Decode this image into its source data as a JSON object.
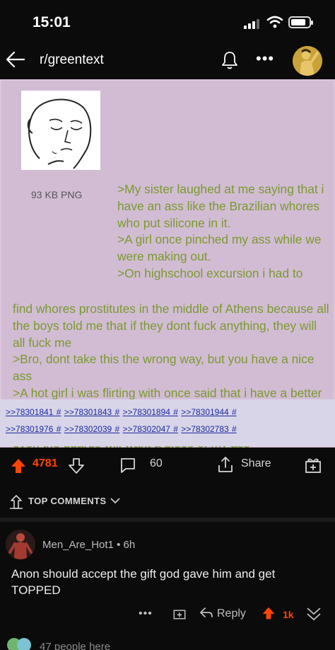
{
  "status_bar": {
    "time": "15:01",
    "battery_level": 0.85
  },
  "header": {
    "subreddit": "r/greentext",
    "more_label": "•••"
  },
  "post": {
    "image_caption": "93 KB PNG",
    "greentext_right": ">My sister laughed at me saying that i have an ass like the Brazilian whores who put silicone in it.\n>A girl once pinched my ass while we were making out.\n>On highschool excursion i had to",
    "greentext_full": "find whores prostitutes in the middle of Athens because all the boys told me that if they dont fuck anything, they will all fuck me\n>Bro, dont take this the wrong way, but you have a nice ass\n>A hot girl i was flirting with once said that i have a better ass than her, and then grabbed it with both hands\n>A drug detective said that i should never EVER go to jail, even the guards will want a piece of my ass",
    "refs_line1": [
      ">>78301841 #",
      ">>78301843 #",
      ">>78301894 #",
      ">>78301944 #"
    ],
    "refs_line2": [
      ">>78301976 #",
      ">>78302039 #",
      ">>78302047 #",
      ">>78302783 #"
    ]
  },
  "actions": {
    "votes": "4781",
    "comments": "60",
    "share": "Share"
  },
  "comments_section": {
    "sort_label": "TOP COMMENTS",
    "comment": {
      "author": "Men_Are_Hot1",
      "age": "6h",
      "separator": "•",
      "body": "Anon should accept the gift god gave him and get TOPPED",
      "reply_label": "Reply",
      "score": "1k",
      "more_label": "•••"
    },
    "more_people": "47 people here"
  },
  "colors": {
    "upvote": "#ff4500",
    "greentext": "#7a9a2e",
    "panel_bg": "#d2bcd4",
    "link": "#1c2aa0"
  }
}
